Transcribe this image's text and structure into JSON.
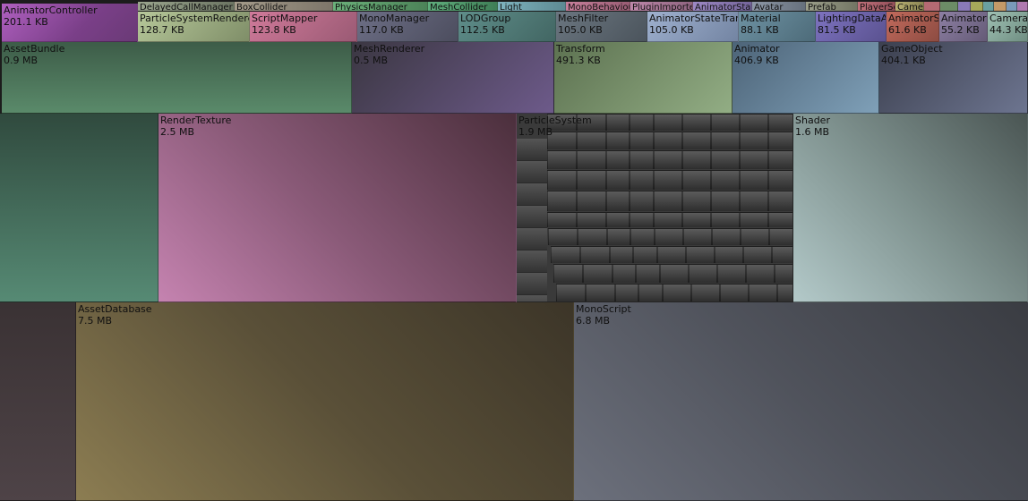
{
  "treemap": {
    "tiny_items": [
      {
        "label": "DelayedCallManager"
      },
      {
        "label": "BoxCollider"
      },
      {
        "label": "PhysicsManager"
      },
      {
        "label": "MeshCollider"
      },
      {
        "label": "Light"
      },
      {
        "label": "MonoBehaviour"
      },
      {
        "label": "PluginImporter"
      },
      {
        "label": "AnimatorStateMachine"
      },
      {
        "label": "Avatar"
      },
      {
        "label": "Prefab"
      },
      {
        "label": "PlayerSettings"
      },
      {
        "label": "Camera"
      }
    ],
    "row1": [
      {
        "name": "AnimatorController",
        "size": "201.1 KB"
      },
      {
        "name": "ParticleSystemRenderer",
        "size": "128.7 KB"
      },
      {
        "name": "ScriptMapper",
        "size": "123.8 KB"
      },
      {
        "name": "MonoManager",
        "size": "117.0 KB"
      },
      {
        "name": "LODGroup",
        "size": "112.5 KB"
      },
      {
        "name": "MeshFilter",
        "size": "105.0 KB"
      },
      {
        "name": "AnimatorStateTransition",
        "size": "105.0 KB"
      },
      {
        "name": "Material",
        "size": "88.1 KB"
      },
      {
        "name": "LightingDataAsset",
        "size": "81.5 KB"
      },
      {
        "name": "AnimatorState",
        "size": "61.6 KB"
      },
      {
        "name": "AnimatorOverrideController",
        "size": "55.2 KB"
      },
      {
        "name": "Camera",
        "size": "44.3 KB"
      }
    ],
    "row2": [
      {
        "name": "AssetBundle",
        "size": "0.9 MB"
      },
      {
        "name": "MeshRenderer",
        "size": "0.5 MB"
      },
      {
        "name": "Transform",
        "size": "491.3 KB"
      },
      {
        "name": "Animator",
        "size": "406.9 KB"
      },
      {
        "name": "GameObject",
        "size": "404.1 KB"
      }
    ],
    "row3": [
      {
        "name": "RenderTexture",
        "size": "2.5 MB"
      },
      {
        "name": "ParticleSystem",
        "size": "1.9 MB"
      },
      {
        "name": "Shader",
        "size": "1.6 MB"
      }
    ],
    "row4": [
      {
        "name": "AssetDatabase",
        "size": "7.5 MB"
      },
      {
        "name": "MonoScript",
        "size": "6.8 MB"
      }
    ]
  }
}
